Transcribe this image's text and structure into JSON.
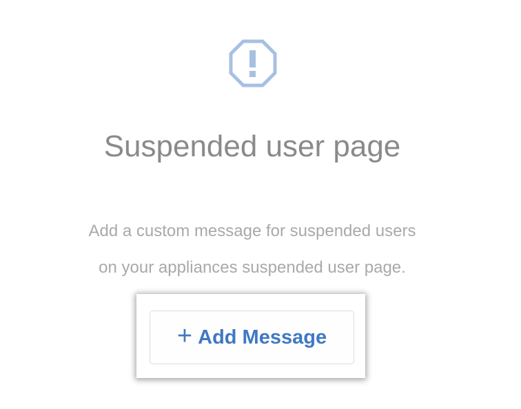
{
  "icon": "alert-octagon-icon",
  "title": "Suspended user page",
  "description": [
    "Add a custom message for suspended users",
    "on your appliances suspended user page."
  ],
  "add_button": {
    "icon": "plus-icon",
    "label": "Add Message"
  },
  "colors": {
    "accent": "#3f78c3",
    "icon": "#a7c0e2"
  }
}
